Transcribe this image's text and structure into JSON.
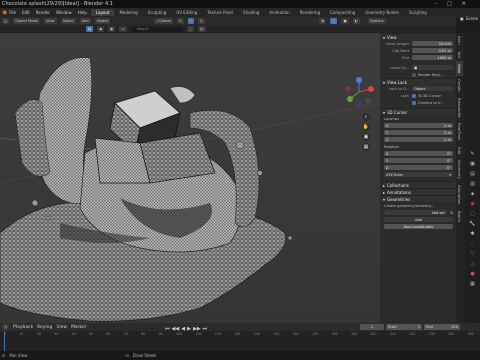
{
  "window": {
    "title": "Chocolate splash(29/29)[Ideal] - Blender 4.1",
    "controls": [
      "–",
      "□",
      "✕"
    ]
  },
  "menubar": {
    "items": [
      "File",
      "Edit",
      "Render",
      "Window",
      "Help"
    ],
    "workspaces": [
      {
        "label": "Layout",
        "active": true
      },
      {
        "label": "Modeling"
      },
      {
        "label": "Sculpting"
      },
      {
        "label": "UV Editing"
      },
      {
        "label": "Texture Paint"
      },
      {
        "label": "Shading"
      },
      {
        "label": "Animation"
      },
      {
        "label": "Rendering"
      },
      {
        "label": "Compositing"
      },
      {
        "label": "Geometry Nodes"
      },
      {
        "label": "Scripting"
      }
    ],
    "scene": "Scene"
  },
  "header": {
    "mode": "Object Mode",
    "view": "View",
    "select": "Select",
    "add": "Add",
    "object": "Object",
    "transform": "Global",
    "options": "Options"
  },
  "header2": {
    "search_placeholder": "Search"
  },
  "npanel": {
    "view_header": "View",
    "focal_length": {
      "label": "Focal Length",
      "value": "50 mm"
    },
    "clip_start": {
      "label": "Clip Start",
      "value": "0.01 m"
    },
    "clip_end": {
      "label": "End",
      "value": "1000 m"
    },
    "local_camera": {
      "label": "Local Ca..."
    },
    "render_region": "Render Regi...",
    "view_lock_header": "View Lock",
    "lock_to_object": {
      "label": "Lock to O...",
      "value": "Object"
    },
    "lock": {
      "label": "Lock",
      "option1": "To 3D Cursor",
      "option2": "Camera to V..."
    },
    "cursor_header": "3D Cursor",
    "location_label": "Location",
    "location": [
      {
        "axis": "X",
        "value": "0 m"
      },
      {
        "axis": "Y",
        "value": "0 m"
      },
      {
        "axis": "Z",
        "value": "0 m"
      }
    ],
    "rotation_label": "Rotation",
    "rotation": [
      {
        "axis": "X",
        "value": "0°"
      },
      {
        "axis": "Y",
        "value": "0°"
      },
      {
        "axis": "Z",
        "value": "0°"
      }
    ],
    "rotation_mode": "XYZ Euler",
    "collections": "Collections",
    "annotations": "Annotations",
    "geometries": "Geometries",
    "geometry_text": "Create geometry/ancestry...",
    "not_set": "Not set",
    "add": "Add",
    "non_coordinates": "Non-Coordinates"
  },
  "ntabs": [
    "Item",
    "Tool",
    "View",
    "Create",
    "BlenderKit",
    "RealTime",
    "Edit",
    "Geometry",
    "Animation",
    "Batch"
  ],
  "timeline": {
    "playback": "Playback",
    "keying": "Keying",
    "view": "View",
    "marker": "Marker",
    "current_frame": "1",
    "start_label": "Start",
    "start": "1",
    "end_label": "End",
    "end": "250"
  },
  "timeline_ticks": [
    "0",
    "10",
    "20",
    "30",
    "40",
    "50",
    "60",
    "70",
    "80",
    "90",
    "100",
    "110",
    "120",
    "130",
    "140",
    "150",
    "160",
    "170",
    "180",
    "190",
    "200",
    "210",
    "220",
    "230",
    "240",
    "250"
  ],
  "status": {
    "left": "Pan View",
    "middle": "Draw Sheet"
  }
}
